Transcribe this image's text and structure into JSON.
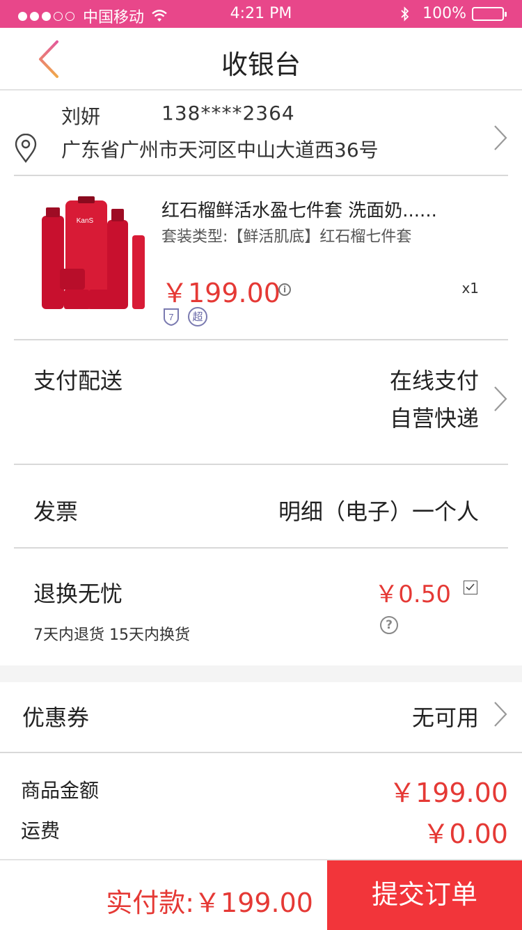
{
  "status_bar": {
    "carrier": "中国移动",
    "time": "4:21 PM",
    "battery": "100%",
    "signal_icon": "signal-dots-icon",
    "wifi_icon": "wifi-icon",
    "bluetooth_icon": "bluetooth-icon",
    "color": "#e8478a"
  },
  "nav": {
    "title": "收银台",
    "back_icon": "back-chevron-icon"
  },
  "address": {
    "name": "刘妍",
    "phone": "138****2364",
    "detail": "广东省广州市天河区中山大道西36号",
    "icon": "location-pin-icon"
  },
  "product": {
    "title": "红石榴鲜活水盈七件套 洗面奶......",
    "spec": "套装类型:【鲜活肌底】红石榴七件套",
    "price": "￥199.00",
    "quantity": "x1",
    "badge_7": "7",
    "badge_chao": "超",
    "image_brand": "KanS"
  },
  "delivery": {
    "label": "支付配送",
    "payment": "在线支付",
    "shipping": "自营快递"
  },
  "invoice": {
    "label": "发票",
    "value": "明细（电子）一个人"
  },
  "return_service": {
    "label": "退换无忧",
    "price": "￥0.50",
    "sub": "7天内退货 15天内换货",
    "checked": true
  },
  "coupon": {
    "label": "优惠券",
    "value": "无可用"
  },
  "summary": {
    "goods_label": "商品金额",
    "goods_value": "￥199.00",
    "shipping_label": "运费",
    "shipping_value": "￥0.00"
  },
  "footer": {
    "total": "实付款:￥199.00",
    "submit": "提交订单",
    "submit_color": "#f2353a",
    "price_color": "#e53935"
  }
}
